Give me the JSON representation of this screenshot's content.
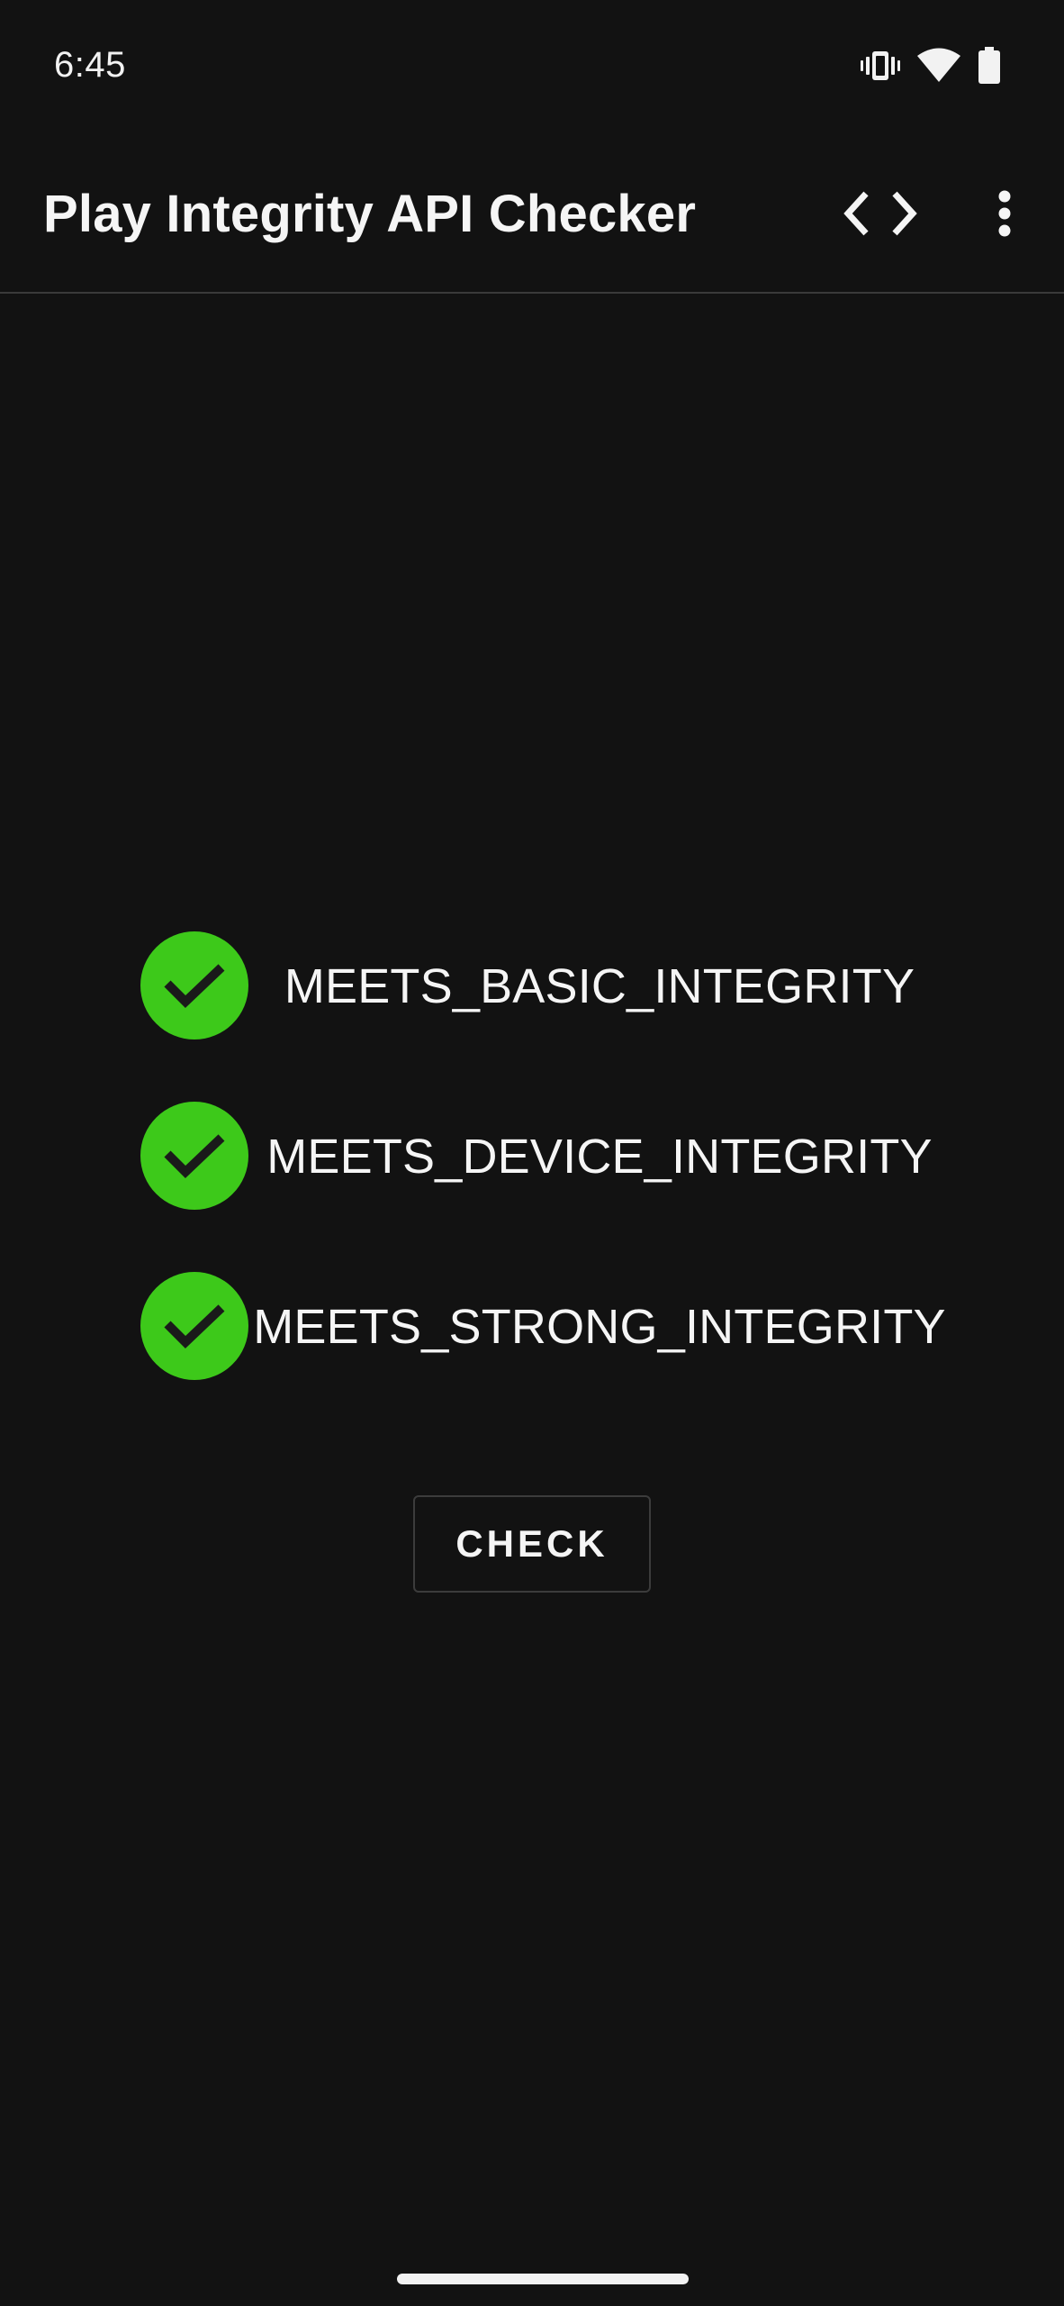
{
  "status_bar": {
    "time": "6:45",
    "icons": [
      "vibrate-icon",
      "wifi-icon",
      "battery-icon"
    ]
  },
  "app_bar": {
    "title": "Play Integrity API Checker",
    "actions": [
      "code-icon",
      "more-vert-icon"
    ]
  },
  "results": [
    {
      "label": "MEETS_BASIC_INTEGRITY",
      "status": "pass",
      "icon": "check-circle-icon"
    },
    {
      "label": "MEETS_DEVICE_INTEGRITY",
      "status": "pass",
      "icon": "check-circle-icon"
    },
    {
      "label": "MEETS_STRONG_INTEGRITY",
      "status": "pass",
      "icon": "check-circle-icon"
    }
  ],
  "check_button": {
    "label": "CHECK"
  },
  "colors": {
    "background": "#121212",
    "pass_green": "#3dc91a",
    "text": "#f5f5f5",
    "divider": "#3a3a3a"
  }
}
